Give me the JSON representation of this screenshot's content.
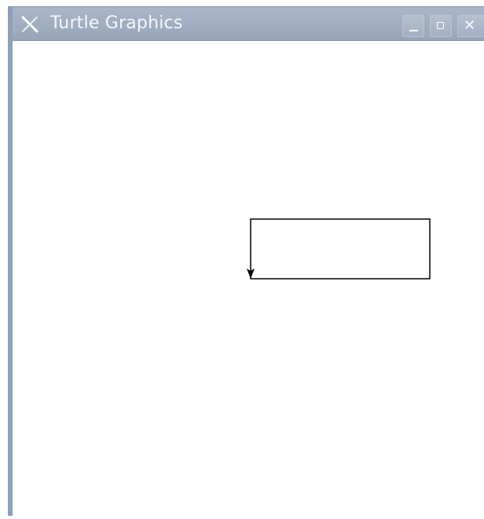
{
  "window": {
    "title": "Turtle Graphics",
    "icon": "x-icon"
  },
  "controls": {
    "minimize_icon": "minimize-icon",
    "maximize_icon": "maximize-icon",
    "close_icon": "close-icon",
    "close_glyph": "✕"
  },
  "canvas": {
    "background": "#ffffff",
    "pen_color": "#000000",
    "drawing": "rectangle",
    "turtle_heading": "down",
    "turtle_icon": "turtle-arrow-icon"
  }
}
